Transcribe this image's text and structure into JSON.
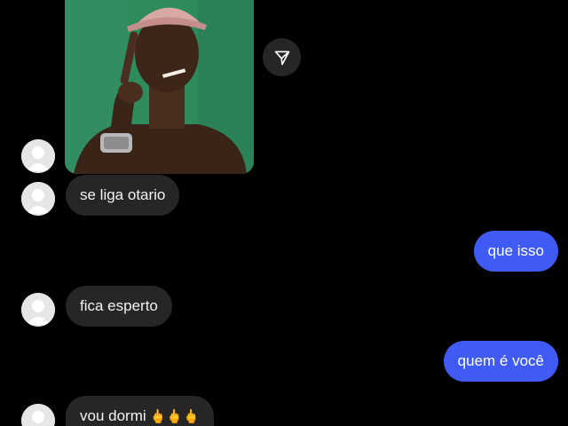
{
  "shared_post": {
    "image_icon": "person-photo",
    "share_icon": "paper-plane-icon"
  },
  "messages": [
    {
      "side": "in",
      "text": "se liga otario"
    },
    {
      "side": "out",
      "text": "que isso"
    },
    {
      "side": "in",
      "text": "fica esperto"
    },
    {
      "side": "out",
      "text": "quem é você"
    },
    {
      "side": "in",
      "text": "vou dormi",
      "emoji": "🖕🖕🖕"
    }
  ],
  "colors": {
    "background": "#000000",
    "incoming_bubble": "#262626",
    "outgoing_bubble": "#3f5bf3"
  }
}
